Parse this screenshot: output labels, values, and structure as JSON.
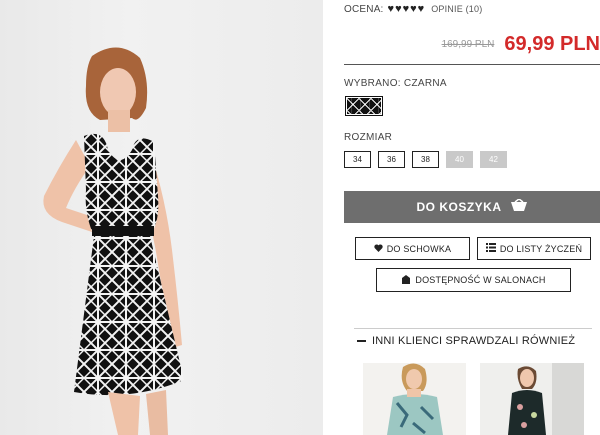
{
  "rating": {
    "label": "OCENA:",
    "stars": "♥♥♥♥♥",
    "reviews": "OPINIE (10)"
  },
  "price": {
    "old": "169,99 PLN",
    "new": "69,99 PLN"
  },
  "selected": {
    "label": "WYBRANO: CZARNA"
  },
  "size": {
    "label": "ROZMIAR",
    "options": [
      "34",
      "36",
      "38",
      "40",
      "42"
    ]
  },
  "cart": {
    "label": "DO KOSZYKA"
  },
  "actions": {
    "stash": "DO SCHOWKA",
    "wishlist": "DO LISTY ŻYCZEŃ",
    "stores": "DOSTĘPNOŚĆ W SALONACH"
  },
  "recommended": {
    "title": "INNI KLIENCI SPRAWDZALI RÓWNIEŻ"
  },
  "colors": {
    "price_red": "#d32a2a",
    "cart_bg": "#6e6e6e",
    "disabled": "#c9c9c9"
  },
  "icons": [
    "heart-icon",
    "list-icon",
    "cart-icon",
    "store-icon",
    "minus-icon"
  ]
}
